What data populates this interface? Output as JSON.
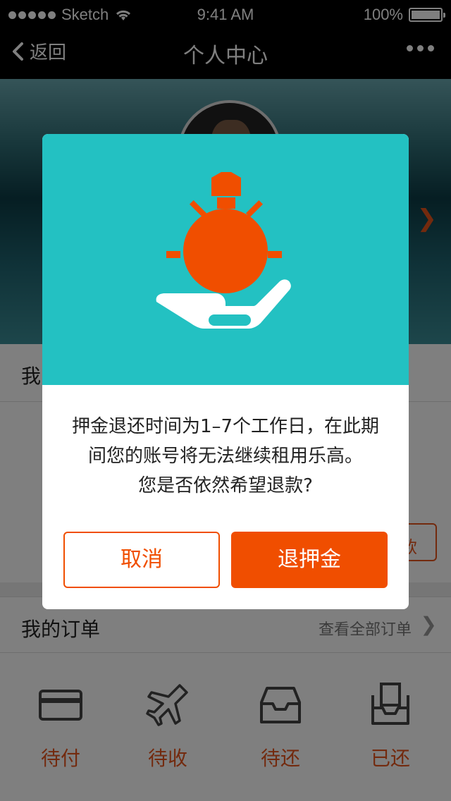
{
  "status_bar": {
    "carrier": "Sketch",
    "time": "9:41 AM",
    "battery": "100%"
  },
  "nav": {
    "back_label": "返回",
    "title": "个人中心"
  },
  "background": {
    "section_title_partial": "我",
    "button_partial": "款",
    "orders": {
      "title": "我的订单",
      "view_all": "查看全部订单",
      "items": [
        {
          "label": "待付",
          "icon": "card-icon"
        },
        {
          "label": "待收",
          "icon": "airplane-icon"
        },
        {
          "label": "待还",
          "icon": "inbox-icon"
        },
        {
          "label": "已还",
          "icon": "box-icon"
        }
      ]
    }
  },
  "modal": {
    "message_lines": [
      "押金退还时间为1–7个工作日，在此期",
      "间您的账号将无法继续租用乐高。",
      "您是否依然希望退款?"
    ],
    "cancel_label": "取消",
    "confirm_label": "退押金",
    "colors": {
      "accent": "#f04e00",
      "header_bg": "#23c1c2"
    }
  }
}
